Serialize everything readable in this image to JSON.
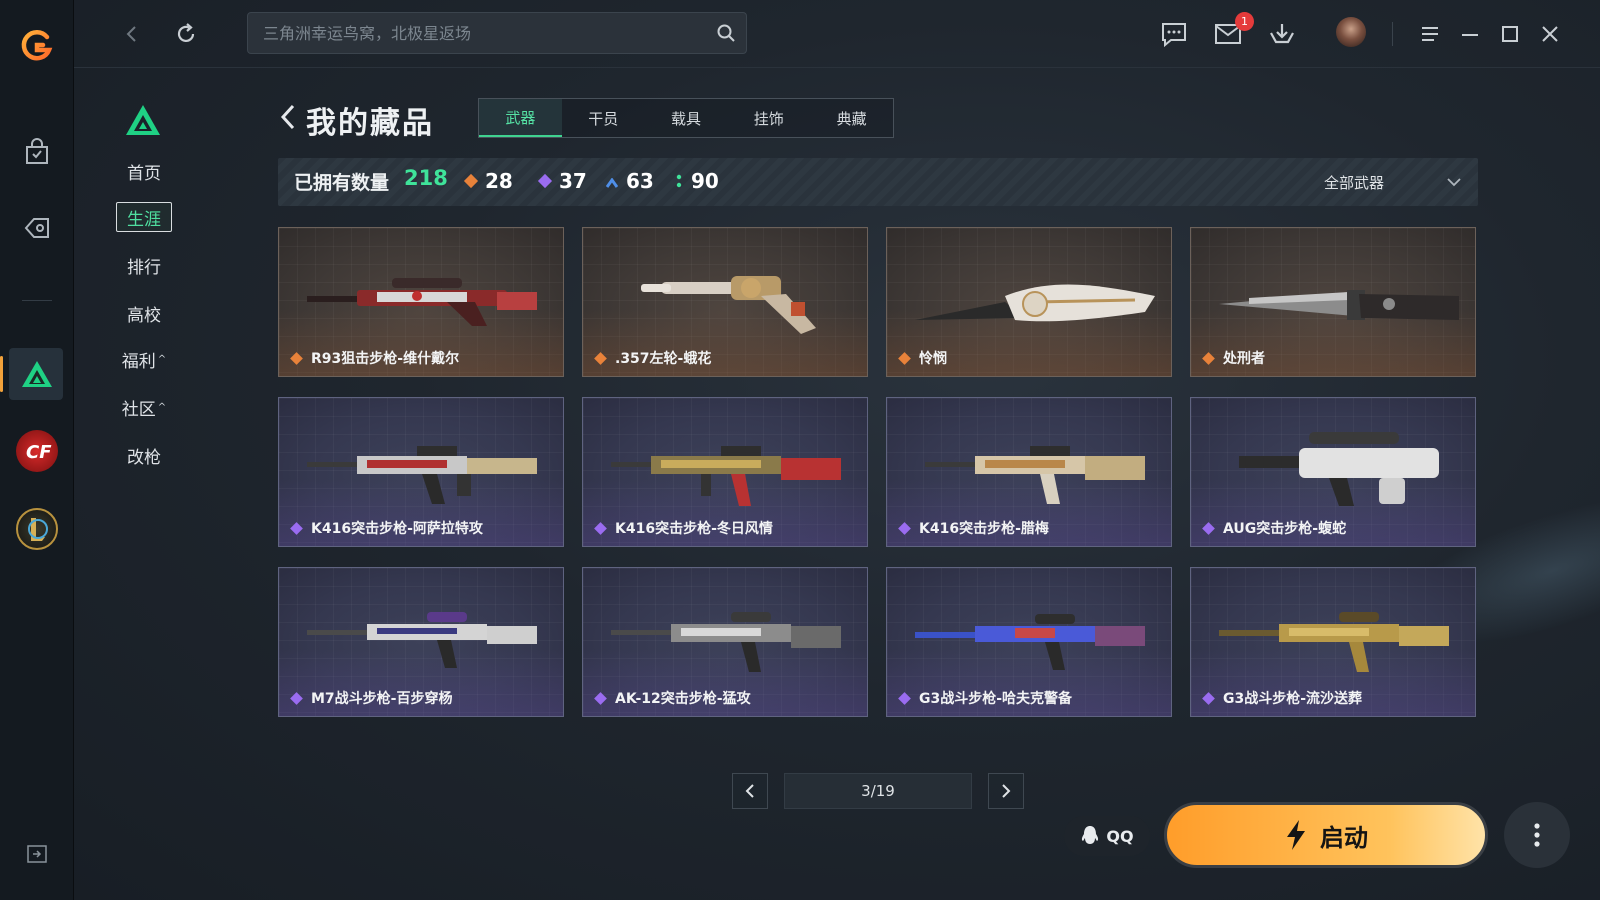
{
  "search": {
    "placeholder": "三角洲幸运鸟窝，北极星返场"
  },
  "topbar": {
    "notification_count": "1"
  },
  "nav": {
    "items": [
      {
        "label": "首页",
        "caret": ""
      },
      {
        "label": "生涯",
        "caret": ""
      },
      {
        "label": "排行",
        "caret": ""
      },
      {
        "label": "高校",
        "caret": ""
      },
      {
        "label": "福利",
        "caret": "^"
      },
      {
        "label": "社区",
        "caret": "^"
      },
      {
        "label": "改枪",
        "caret": ""
      }
    ],
    "active_index": 1
  },
  "page": {
    "title": "我的藏品",
    "tabs": [
      "武器",
      "干员",
      "载具",
      "挂饰",
      "典藏"
    ],
    "active_tab": 0
  },
  "stats": {
    "owned_label": "已拥有数量",
    "owned_count": "218",
    "counts": [
      {
        "value": "28",
        "color": "#e8823a"
      },
      {
        "value": "37",
        "color": "#9a6cf0"
      },
      {
        "value": "63",
        "color": "#4f8fe8"
      },
      {
        "value": "90",
        "color": "#3fe39a"
      }
    ],
    "filter_label": "全部武器"
  },
  "items": [
    {
      "name": "R93狙击步枪-维什戴尔",
      "rarity": "gold",
      "icon": "sniper-rifle-icon"
    },
    {
      "name": ".357左轮-蛾花",
      "rarity": "gold",
      "icon": "revolver-icon"
    },
    {
      "name": "怜悯",
      "rarity": "gold",
      "icon": "knife-icon"
    },
    {
      "name": "处刑者",
      "rarity": "gold",
      "icon": "knife-icon"
    },
    {
      "name": "K416突击步枪-阿萨拉特攻",
      "rarity": "purple",
      "icon": "assault-rifle-icon"
    },
    {
      "name": "K416突击步枪-冬日风情",
      "rarity": "purple",
      "icon": "assault-rifle-icon"
    },
    {
      "name": "K416突击步枪-腊梅",
      "rarity": "purple",
      "icon": "assault-rifle-icon"
    },
    {
      "name": "AUG突击步枪-蝮蛇",
      "rarity": "purple",
      "icon": "bullpup-rifle-icon"
    },
    {
      "name": "M7战斗步枪-百步穿杨",
      "rarity": "purple",
      "icon": "battle-rifle-icon"
    },
    {
      "name": "AK-12突击步枪-猛攻",
      "rarity": "purple",
      "icon": "assault-rifle-icon"
    },
    {
      "name": "G3战斗步枪-哈夫克警备",
      "rarity": "purple",
      "icon": "battle-rifle-icon"
    },
    {
      "name": "G3战斗步枪-流沙送葬",
      "rarity": "purple",
      "icon": "battle-rifle-icon"
    }
  ],
  "rarity_colors": {
    "gold": "#e8823a",
    "purple": "#9a6cf0"
  },
  "pager": {
    "text": "3/19"
  },
  "footer": {
    "qq_label": "QQ",
    "launch_label": "启动"
  }
}
